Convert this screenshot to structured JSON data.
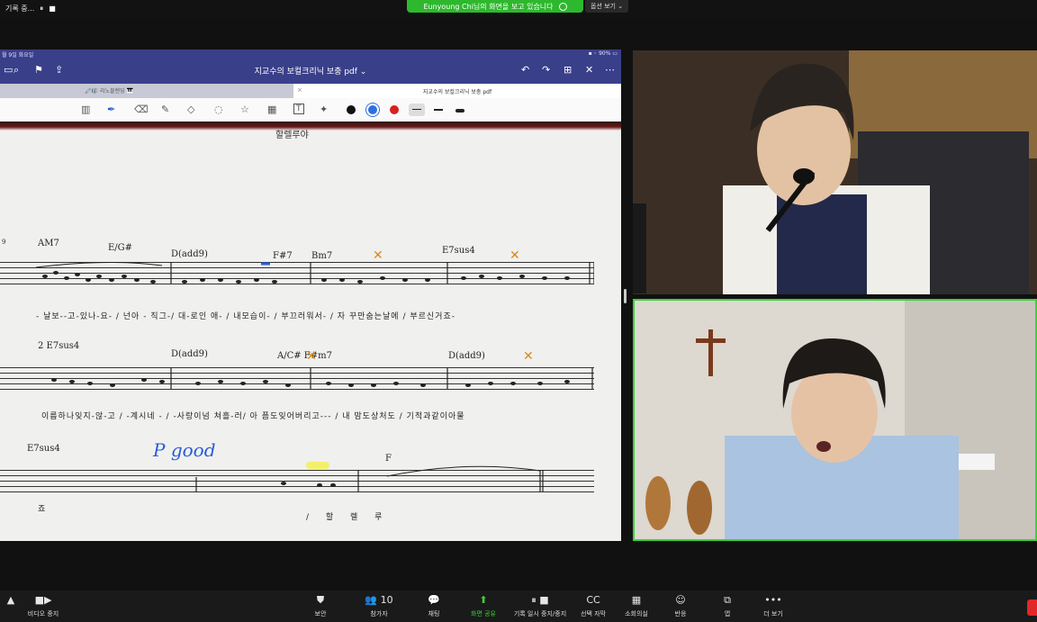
{
  "topbar": {
    "recording_label": "기록 중...",
    "pause_glyph": "⏸",
    "stop_glyph": "■",
    "share_banner": "Eunyoung Chi님의 화면을 보고 있습니다",
    "view_options": "옵션 보기 ⌄"
  },
  "ipad": {
    "status_left": "월 9일 화요일",
    "status_right": "▪ ◦ 90%  ▭",
    "doc_title": "지교수의 보컬크리닉 보충 pdf ⌄",
    "tab_left": "🖍🎼 리노블렌딩  🎹",
    "tab_right": "지교수의 보컬크리닉 보충 pdf",
    "tab_close": "×",
    "nav_icons": {
      "search": "⌕",
      "bookmark": "⚑",
      "share": "⇪",
      "undo": "↶",
      "redo": "↷",
      "add_page": "⊞",
      "close": "✕",
      "more": "⋯"
    },
    "tools": {
      "pen": "✒",
      "eraser": "⌫",
      "highlighter": "✎",
      "shapes": "◇",
      "lasso": "◌",
      "sticker": "☆",
      "image": "▦",
      "text": "T",
      "laser": "✦"
    },
    "colors": [
      "#111111",
      "#2f6fe0",
      "#d82020"
    ],
    "line_weights": [
      "thin",
      "medium",
      "thick"
    ]
  },
  "sheet": {
    "song_title": "할렐루야",
    "chords": [
      {
        "t": "AM7"
      },
      {
        "t": "E/G#"
      },
      {
        "t": "D(add9)"
      },
      {
        "t": "F#7"
      },
      {
        "t": "Bm7"
      },
      {
        "t": "E7sus4"
      },
      {
        "t": "2  E7sus4"
      },
      {
        "t": "D(add9)"
      },
      {
        "t": "A/C# F#m7"
      },
      {
        "t": "D(add9)"
      },
      {
        "t": "E7sus4"
      },
      {
        "t": "F"
      }
    ],
    "lyrics": [
      "-  날보--고-있나-요-  / 넌아  -  직그-/ 대-로인  애-  / 내모습이-  / 부끄러워서-  /  자  꾸만숨는날에 / 부르신거죠-",
      "이름하나잊지-않-고  / -계시네  -  / -사랑이넘  쳐흘-러/ 아  픔도잊어버리고---  / 내  맘도상처도 / 기적과같이아물",
      "죠",
      "/  할  렐  루"
    ],
    "annotation": "P good",
    "measure_number": "9"
  },
  "controls": [
    {
      "icon": "▲",
      "label": ""
    },
    {
      "icon": "■▶",
      "label": "비디오 중지"
    },
    {
      "icon": "⛊",
      "label": "보안"
    },
    {
      "icon": "👥 10",
      "label": "참가자"
    },
    {
      "icon": "💬",
      "label": "채팅"
    },
    {
      "icon": "⬆",
      "label": "화면 공유"
    },
    {
      "icon": "⏸ ■",
      "label": "기록 일시 중지/중지"
    },
    {
      "icon": "CC",
      "label": "선택 자막"
    },
    {
      "icon": "▦",
      "label": "소회의실"
    },
    {
      "icon": "☺",
      "label": "반응"
    },
    {
      "icon": "⧉",
      "label": "앱"
    },
    {
      "icon": "•••",
      "label": "더 보기"
    }
  ]
}
